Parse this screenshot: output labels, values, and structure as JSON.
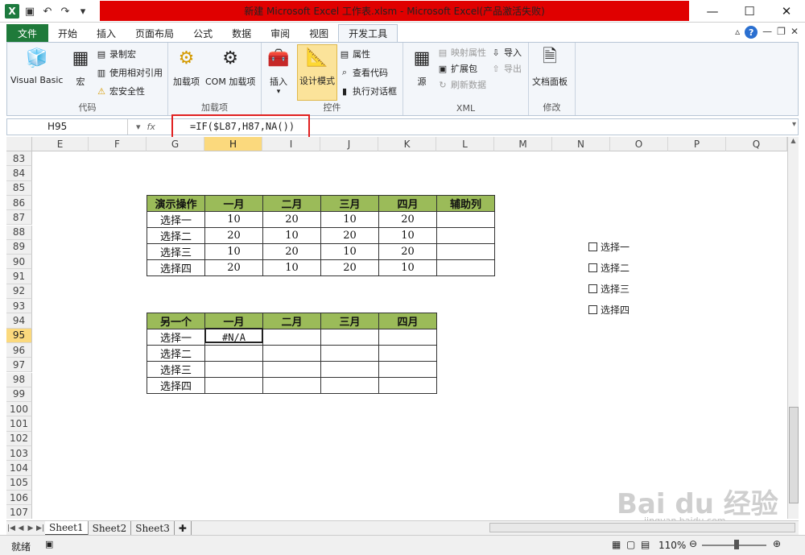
{
  "window": {
    "title": "新建 Microsoft Excel 工作表.xlsm - Microsoft Excel(产品激活失败)"
  },
  "tabs": [
    "文件",
    "开始",
    "插入",
    "页面布局",
    "公式",
    "数据",
    "审阅",
    "视图",
    "开发工具"
  ],
  "ribbon": {
    "groups": {
      "code": "代码",
      "addins": "加载项",
      "controls": "控件",
      "xml": "XML",
      "modify": "修改"
    },
    "buttons": {
      "visual_basic": "Visual Basic",
      "macro": "宏",
      "record_macro": "录制宏",
      "relative_ref": "使用相对引用",
      "macro_security": "宏安全性",
      "addins": "加载项",
      "com_addins": "COM 加载项",
      "insert": "插入",
      "design_mode": "设计模式",
      "properties": "属性",
      "view_code": "查看代码",
      "run_dialog": "执行对话框",
      "source": "源",
      "map_properties": "映射属性",
      "expansion_packs": "扩展包",
      "refresh_data": "刷新数据",
      "import": "导入",
      "export": "导出",
      "doc_panel": "文档面板"
    }
  },
  "formula_bar": {
    "name_box": "H95",
    "fx": "fx",
    "formula": "=IF($L87,H87,NA())"
  },
  "columns": [
    "E",
    "F",
    "G",
    "H",
    "I",
    "J",
    "K",
    "L",
    "M",
    "N",
    "O",
    "P",
    "Q"
  ],
  "rows": [
    "83",
    "84",
    "85",
    "86",
    "87",
    "88",
    "89",
    "90",
    "91",
    "92",
    "93",
    "94",
    "95",
    "96",
    "97",
    "98",
    "99",
    "100",
    "101",
    "102",
    "103",
    "104",
    "105",
    "106",
    "107"
  ],
  "table1": {
    "header": [
      "演示操作",
      "一月",
      "二月",
      "三月",
      "四月",
      "辅助列"
    ],
    "rows": [
      [
        "选择一",
        "10",
        "20",
        "10",
        "20",
        ""
      ],
      [
        "选择二",
        "20",
        "10",
        "20",
        "10",
        ""
      ],
      [
        "选择三",
        "10",
        "20",
        "10",
        "20",
        ""
      ],
      [
        "选择四",
        "20",
        "10",
        "20",
        "10",
        ""
      ]
    ]
  },
  "table2": {
    "header": [
      "另一个",
      "一月",
      "二月",
      "三月",
      "四月"
    ],
    "rows": [
      [
        "选择一",
        "#N/A",
        "",
        "",
        ""
      ],
      [
        "选择二",
        "",
        "",
        "",
        ""
      ],
      [
        "选择三",
        "",
        "",
        "",
        ""
      ],
      [
        "选择四",
        "",
        "",
        "",
        ""
      ]
    ]
  },
  "checkboxes": [
    "选择一",
    "选择二",
    "选择三",
    "选择四"
  ],
  "sheets": [
    "Sheet1",
    "Sheet2",
    "Sheet3"
  ],
  "status": {
    "ready": "就绪",
    "zoom": "110%"
  },
  "watermark": {
    "brand": "Bai du 经验",
    "url": "jingyan.baidu.com"
  }
}
